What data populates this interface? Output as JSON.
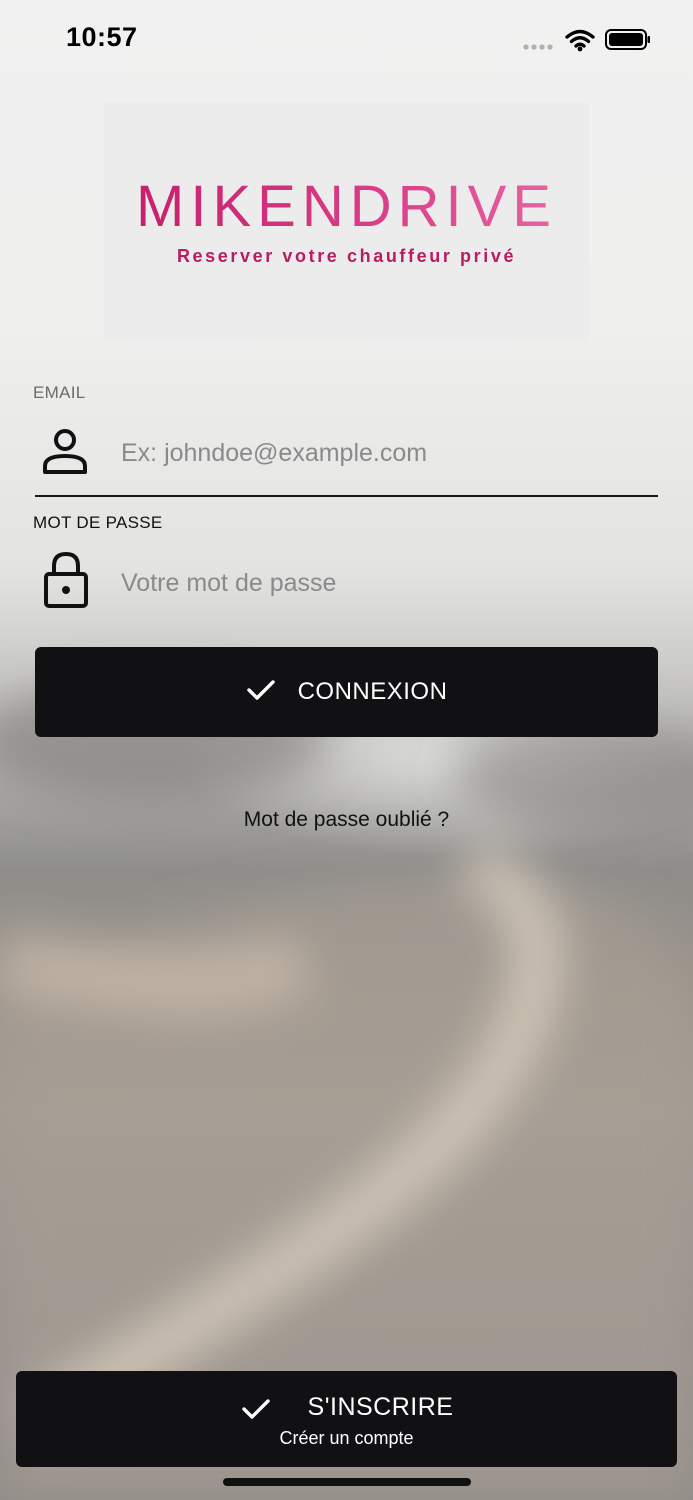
{
  "status_bar": {
    "time": "10:57"
  },
  "logo": {
    "title": "MIKENDRIVE",
    "tagline": "Reserver votre chauffeur privé"
  },
  "form": {
    "email": {
      "label": "EMAIL",
      "placeholder": "Ex: johndoe@example.com",
      "value": ""
    },
    "password": {
      "label": "MOT DE PASSE",
      "placeholder": "Votre mot de passe",
      "value": ""
    },
    "login_label": "CONNEXION",
    "forgot_label": "Mot de passe oublié ?"
  },
  "signup": {
    "label": "S'INSCRIRE",
    "sublabel": "Créer un compte"
  },
  "colors": {
    "brand": "#c41c6b",
    "button_bg": "#111012",
    "button_text": "#ffffff"
  },
  "icons": {
    "email_field": "person-icon",
    "password_field": "lock-icon",
    "login": "checkmark-icon",
    "signup": "checkmark-icon",
    "wifi": "wifi-icon",
    "battery": "battery-icon",
    "signal": "signal-icon"
  }
}
